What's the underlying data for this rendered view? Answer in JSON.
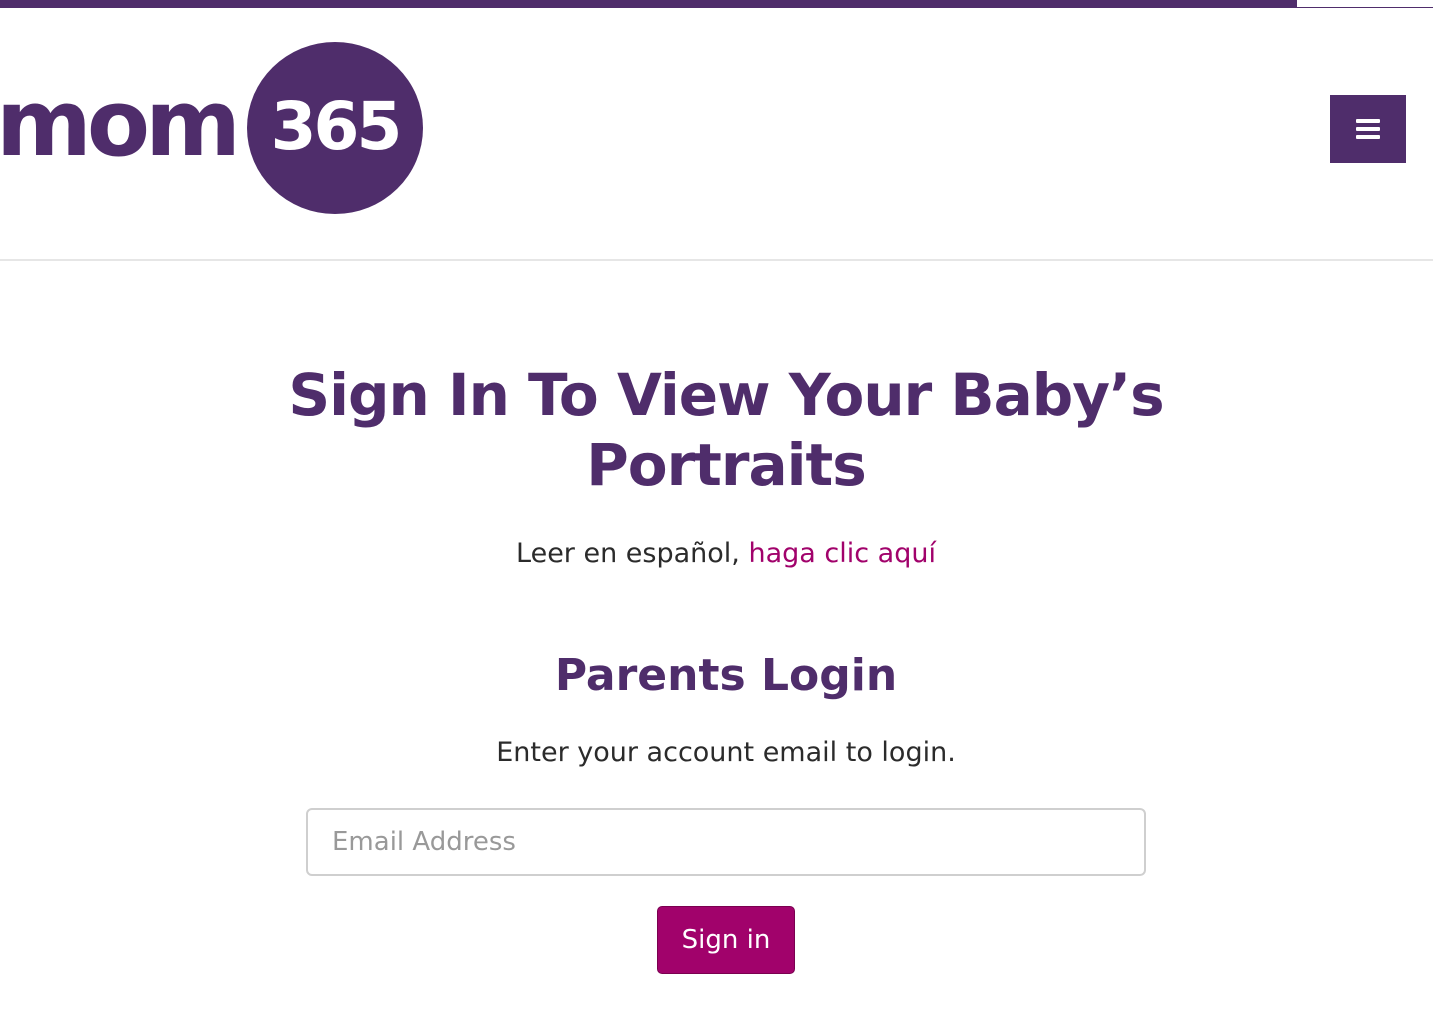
{
  "logo": {
    "word": "mom",
    "number": "365"
  },
  "header": {
    "menu_icon": "hamburger-menu-icon"
  },
  "main": {
    "title": "Sign In To View Your Baby’s Portraits",
    "spanish_prefix": "Leer en español, ",
    "spanish_link": "haga clic aquí",
    "login_heading": "Parents Login",
    "instructions": "Enter your account email to login.",
    "email_placeholder": "Email Address",
    "email_value": "",
    "signin_label": "Sign in"
  },
  "colors": {
    "brand_purple": "#4f2d6b",
    "accent_magenta": "#a1026b",
    "body_text": "#2b2b2b"
  }
}
